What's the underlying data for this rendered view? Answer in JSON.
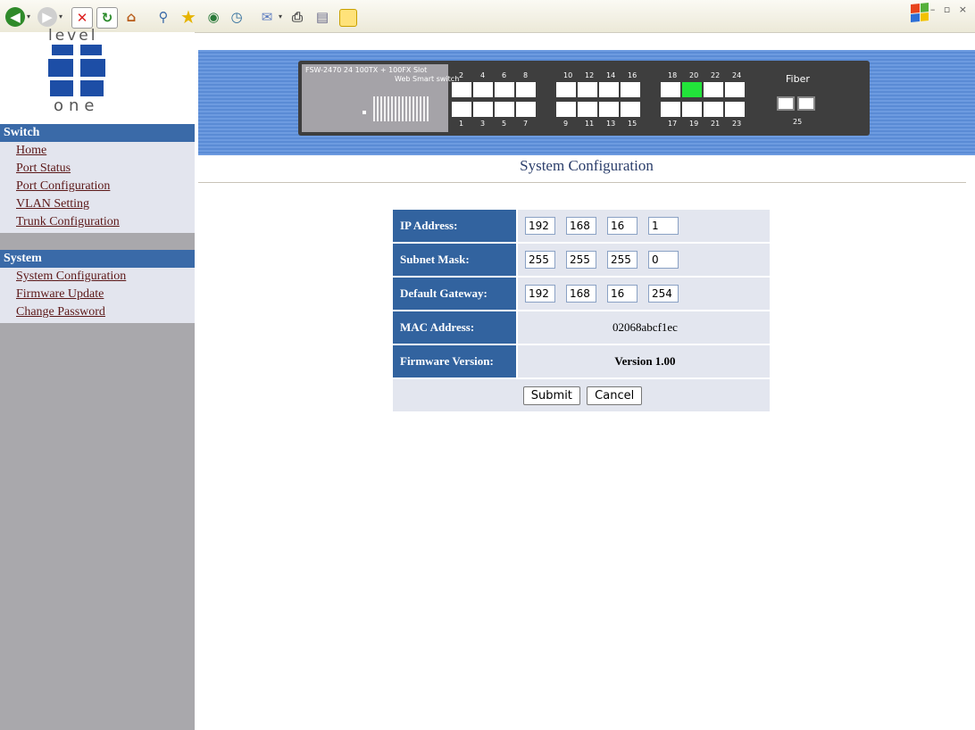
{
  "logo": {
    "top_text": "level",
    "bottom_text": "one"
  },
  "sidebar": {
    "switch_section": {
      "title": "Switch",
      "items": [
        "Home",
        "Port Status",
        "Port Configuration",
        "VLAN Setting",
        "Trunk Configuration"
      ]
    },
    "system_section": {
      "title": "System",
      "items": [
        "System Configuration",
        "Firmware Update",
        "Change Password"
      ]
    }
  },
  "switch_image": {
    "model_label": "FSW-2470  24 100TX + 100FX Slot",
    "subtitle": "Web Smart switch",
    "top_ports": [
      "2",
      "4",
      "6",
      "8",
      "10",
      "12",
      "14",
      "16",
      "18",
      "20",
      "22",
      "24"
    ],
    "bottom_ports": [
      "1",
      "3",
      "5",
      "7",
      "9",
      "11",
      "13",
      "15",
      "17",
      "19",
      "21",
      "23"
    ],
    "active_port": "20",
    "fiber_label": "Fiber",
    "fiber_port": "25"
  },
  "page": {
    "title": "System Configuration"
  },
  "form": {
    "ip_label": "IP Address:",
    "ip": [
      "192",
      "168",
      "16",
      "1"
    ],
    "mask_label": "Subnet Mask:",
    "mask": [
      "255",
      "255",
      "255",
      "0"
    ],
    "gateway_label": "Default Gateway:",
    "gateway": [
      "192",
      "168",
      "16",
      "254"
    ],
    "mac_label": "MAC Address:",
    "mac": "02068abcf1ec",
    "firmware_label": "Firmware Version:",
    "firmware": "Version 1.00",
    "submit": "Submit",
    "cancel": "Cancel"
  },
  "colors": {
    "accent": "#3a6aa8",
    "port_lit": "#22e33a",
    "link": "#5c1818"
  }
}
